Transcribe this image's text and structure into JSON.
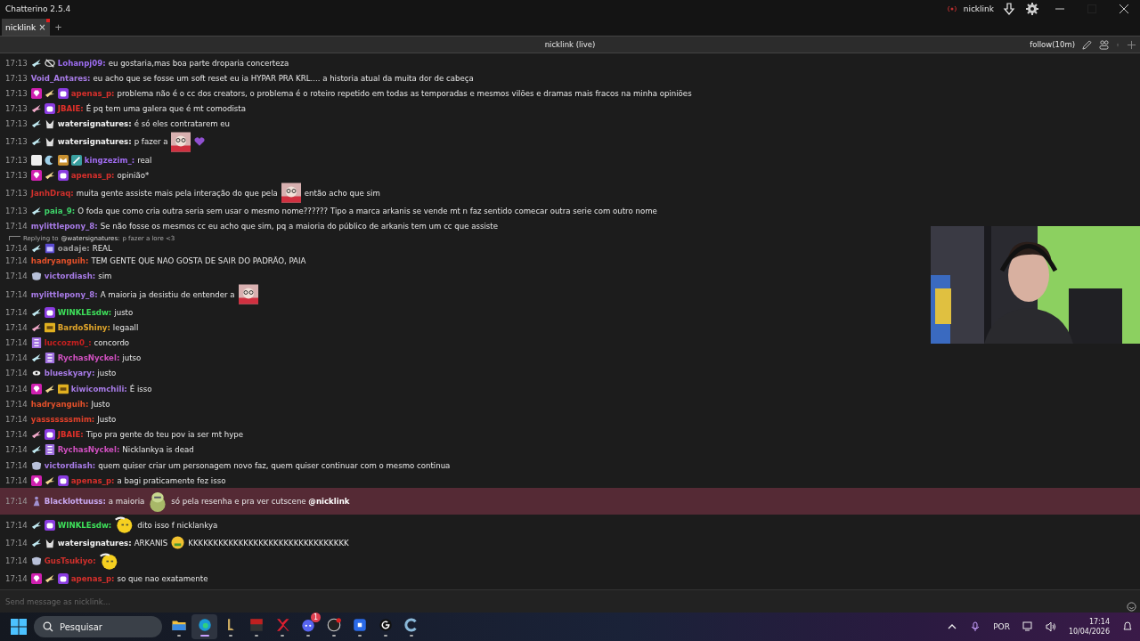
{
  "window": {
    "title": "Chatterino 2.5.4",
    "account": "nicklink"
  },
  "tabs": [
    {
      "label": "nicklink",
      "selected": true,
      "close": "×"
    }
  ],
  "add_tab": "+",
  "channel": {
    "title": "nicklink (live)",
    "follow": "follow(10m)"
  },
  "messages": [
    {
      "time": "17:13",
      "badges": [
        {
          "kind": "wing"
        },
        {
          "kind": "eyeslash"
        }
      ],
      "user": "Lohanpj09:",
      "color": "#9c6cf0",
      "parts": [
        {
          "kind": "text",
          "text": "eu gostaria,mas boa parte droparia concerteza"
        }
      ]
    },
    {
      "time": "17:13",
      "user": "Void_Antares:",
      "color": "#a77be6",
      "parts": [
        {
          "kind": "text",
          "text": "eu acho que se fosse um soft reset eu ia HYPAR PRA KRL.... a historia atual da muita dor de cabeça"
        }
      ]
    },
    {
      "time": "17:13",
      "badges": [
        {
          "kind": "gem"
        },
        {
          "kind": "goldwing"
        },
        {
          "kind": "sub"
        }
      ],
      "user": "apenas_p:",
      "color": "#d9302c",
      "parts": [
        {
          "kind": "text",
          "text": "problema não é o cc dos creators, o problema é o roteiro repetido em todas as temporadas e mesmos vilões e dramas mais fracos na minha opiniões"
        }
      ]
    },
    {
      "time": "17:13",
      "badges": [
        {
          "kind": "rosewing"
        },
        {
          "kind": "sub"
        }
      ],
      "user": "JBAIE:",
      "color": "#e0302a",
      "parts": [
        {
          "kind": "text",
          "text": "É pq tem uma galera que é mt comodista"
        }
      ]
    },
    {
      "time": "17:13",
      "badges": [
        {
          "kind": "wing"
        },
        {
          "kind": "horns"
        }
      ],
      "user": "watersignatures:",
      "color": "#f2f2f2",
      "parts": [
        {
          "kind": "text",
          "text": "é só eles contratarem eu"
        }
      ]
    },
    {
      "time": "17:13",
      "badges": [
        {
          "kind": "wing"
        },
        {
          "kind": "horns"
        }
      ],
      "user": "watersignatures:",
      "color": "#f2f2f2",
      "parts": [
        {
          "kind": "text",
          "text": "p fazer a"
        },
        {
          "kind": "cat"
        },
        {
          "kind": "heart"
        }
      ]
    },
    {
      "time": "17:13",
      "badges": [
        {
          "kind": "face"
        },
        {
          "kind": "crescent"
        },
        {
          "kind": "crown"
        },
        {
          "kind": "pixel"
        }
      ],
      "user": "kingzezim_:",
      "color": "#a06cf0",
      "parts": [
        {
          "kind": "text",
          "text": "real"
        }
      ]
    },
    {
      "time": "17:13",
      "badges": [
        {
          "kind": "gem"
        },
        {
          "kind": "goldwing"
        },
        {
          "kind": "sub"
        }
      ],
      "user": "apenas_p:",
      "color": "#d9302c",
      "parts": [
        {
          "kind": "text",
          "text": "opinião*"
        }
      ]
    },
    {
      "time": "17:13",
      "user": "JanhDraq:",
      "color": "#d0302c",
      "parts": [
        {
          "kind": "text",
          "text": "muita gente assiste mais pela interação do que pela"
        },
        {
          "kind": "cat"
        },
        {
          "kind": "text",
          "text": "então acho que sim"
        }
      ]
    },
    {
      "time": "17:13",
      "badges": [
        {
          "kind": "wing"
        }
      ],
      "user": "paia_9:",
      "color": "#3fd46a",
      "parts": [
        {
          "kind": "text",
          "text": "O foda que como cria outra seria sem usar o mesmo nome?????? Tipo a marca arkanis se vende mt n faz sentido comecar outra serie com outro nome"
        }
      ]
    },
    {
      "time": "17:14",
      "user": "mylittlepony_8:",
      "color": "#a77be6",
      "parts": [
        {
          "kind": "text",
          "text": "Se não fosse os mesmos cc eu acho que sim, pq a maioria do público de arkanis tem um cc que assiste"
        }
      ]
    },
    {
      "reply": "Replying to",
      "reply_user": "@watersignatures:",
      "reply_text": "p fazer a lore <3",
      "time": "17:14",
      "badges": [
        {
          "kind": "wing"
        },
        {
          "kind": "calendar"
        }
      ],
      "user": "oadaje:",
      "color": "#9a9a9a",
      "parts": [
        {
          "kind": "text",
          "text": "REAL"
        }
      ]
    },
    {
      "time": "17:14",
      "user": "hadryanguih:",
      "color": "#e2502a",
      "parts": [
        {
          "kind": "text",
          "text": "TEM GENTE QUE NAO GOSTA DE SAIR DO PADRÃO, PAIA"
        }
      ]
    },
    {
      "time": "17:14",
      "badges": [
        {
          "kind": "mask"
        }
      ],
      "user": "victordiash:",
      "color": "#a77be6",
      "parts": [
        {
          "kind": "text",
          "text": "sim"
        }
      ]
    },
    {
      "time": "17:14",
      "user": "mylittlepony_8:",
      "color": "#a77be6",
      "parts": [
        {
          "kind": "text",
          "text": "A maioria ja desistiu de entender a"
        },
        {
          "kind": "cat"
        }
      ]
    },
    {
      "time": "17:14",
      "badges": [
        {
          "kind": "wing"
        },
        {
          "kind": "sub"
        }
      ],
      "user": "WINKLEsdw:",
      "color": "#3ee05a",
      "parts": [
        {
          "kind": "text",
          "text": "justo"
        }
      ]
    },
    {
      "time": "17:14",
      "badges": [
        {
          "kind": "rosewing"
        },
        {
          "kind": "goldbox"
        }
      ],
      "user": "BardoShiny:",
      "color": "#e0a52a",
      "parts": [
        {
          "kind": "text",
          "text": "legaall"
        }
      ]
    },
    {
      "time": "17:14",
      "badges": [
        {
          "kind": "glyph"
        }
      ],
      "user": "luccozm0_:",
      "color": "#c82020",
      "parts": [
        {
          "kind": "text",
          "text": "concordo"
        }
      ]
    },
    {
      "time": "17:14",
      "badges": [
        {
          "kind": "wing"
        },
        {
          "kind": "glyph"
        }
      ],
      "user": "RychasNyckel:",
      "color": "#d050c0",
      "parts": [
        {
          "kind": "text",
          "text": "jutso"
        }
      ]
    },
    {
      "time": "17:14",
      "badges": [
        {
          "kind": "eye"
        }
      ],
      "user": "blueskyary:",
      "color": "#a77be6",
      "parts": [
        {
          "kind": "text",
          "text": "justo"
        }
      ]
    },
    {
      "time": "17:14",
      "badges": [
        {
          "kind": "gem"
        },
        {
          "kind": "goldwing"
        },
        {
          "kind": "goldbox"
        }
      ],
      "user": "kiwicomchili:",
      "color": "#a77be6",
      "parts": [
        {
          "kind": "text",
          "text": "É isso"
        }
      ]
    },
    {
      "time": "17:14",
      "user": "hadryanguih:",
      "color": "#e2502a",
      "parts": [
        {
          "kind": "text",
          "text": "Justo"
        }
      ]
    },
    {
      "time": "17:14",
      "user": "yasssssssmim:",
      "color": "#e0402a",
      "parts": [
        {
          "kind": "text",
          "text": "Justo"
        }
      ]
    },
    {
      "time": "17:14",
      "badges": [
        {
          "kind": "rosewing"
        },
        {
          "kind": "sub"
        }
      ],
      "user": "JBAIE:",
      "color": "#e0302a",
      "parts": [
        {
          "kind": "text",
          "text": "Tipo pra gente do teu pov ia ser mt hype"
        }
      ]
    },
    {
      "time": "17:14",
      "badges": [
        {
          "kind": "wing"
        },
        {
          "kind": "glyph"
        }
      ],
      "user": "RychasNyckel:",
      "color": "#d050c0",
      "parts": [
        {
          "kind": "text",
          "text": "Nicklankya is dead"
        }
      ]
    },
    {
      "time": "17:14",
      "badges": [
        {
          "kind": "mask"
        }
      ],
      "user": "victordiash:",
      "color": "#a77be6",
      "parts": [
        {
          "kind": "text",
          "text": "quem quiser criar um personagem novo faz, quem quiser continuar com o mesmo continua"
        }
      ]
    },
    {
      "time": "17:14",
      "badges": [
        {
          "kind": "gem"
        },
        {
          "kind": "goldwing"
        },
        {
          "kind": "sub"
        }
      ],
      "user": "apenas_p:",
      "color": "#d9302c",
      "parts": [
        {
          "kind": "text",
          "text": "a bagi praticamente fez isso"
        }
      ]
    },
    {
      "highlighted": true,
      "time": "17:14",
      "badges": [
        {
          "kind": "figure"
        }
      ],
      "user": "Blacklottuuss:",
      "color": "#c8a8f0",
      "parts": [
        {
          "kind": "text",
          "text": "a maioria"
        },
        {
          "kind": "frog"
        },
        {
          "kind": "text",
          "text": "só pela resenha e pra ver cutscene **@nicklink**"
        }
      ]
    },
    {
      "time": "17:14",
      "badges": [
        {
          "kind": "wing"
        },
        {
          "kind": "sub"
        }
      ],
      "user": "WINKLEsdw:",
      "color": "#3ee05a",
      "parts": [
        {
          "kind": "smiley"
        },
        {
          "kind": "text",
          "text": "dito isso f nicklankya"
        }
      ]
    },
    {
      "time": "17:14",
      "badges": [
        {
          "kind": "wing"
        },
        {
          "kind": "horns"
        }
      ],
      "user": "watersignatures:",
      "color": "#f2f2f2",
      "parts": [
        {
          "kind": "text",
          "text": "ARKANIS"
        },
        {
          "kind": "money"
        },
        {
          "kind": "text",
          "text": "KKKKKKKKKKKKKKKKKKKKKKKKKKKKKKKK"
        }
      ]
    },
    {
      "time": "17:14",
      "badges": [
        {
          "kind": "mask"
        }
      ],
      "user": "GusTsukiyo:",
      "color": "#d0302c",
      "parts": [
        {
          "kind": "smiley"
        }
      ]
    },
    {
      "time": "17:14",
      "badges": [
        {
          "kind": "gem"
        },
        {
          "kind": "goldwing"
        },
        {
          "kind": "sub"
        }
      ],
      "user": "apenas_p:",
      "color": "#d9302c",
      "parts": [
        {
          "kind": "text",
          "text": "so que nao exatamente"
        }
      ]
    }
  ],
  "input": {
    "placeholder": "Send message as nicklink..."
  },
  "taskbar": {
    "search": "Pesquisar",
    "apps": [
      {
        "kind": "folder",
        "active": false
      },
      {
        "kind": "edge",
        "active": true
      },
      {
        "kind": "league",
        "active": false
      },
      {
        "kind": "voicemeeter",
        "active": false
      },
      {
        "kind": "x",
        "active": false
      },
      {
        "kind": "discord",
        "active": false,
        "count": "1"
      },
      {
        "kind": "obs",
        "active": false
      },
      {
        "kind": "roblox",
        "active": false
      },
      {
        "kind": "logitech",
        "active": false
      },
      {
        "kind": "chatterino",
        "active": false
      }
    ],
    "language": "POR",
    "time": "17:14",
    "date": "10/04/2026"
  }
}
